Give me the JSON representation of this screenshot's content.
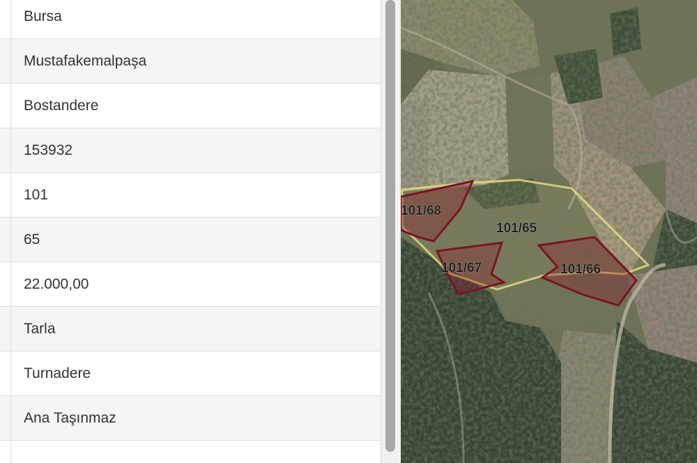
{
  "property_info": {
    "rows": [
      {
        "value": "Bursa"
      },
      {
        "value": "Mustafakemalpaşa"
      },
      {
        "value": "Bostandere"
      },
      {
        "value": "153932"
      },
      {
        "value": "101"
      },
      {
        "value": "65"
      },
      {
        "value": "22.000,00"
      },
      {
        "value": "Tarla"
      },
      {
        "value": "Turnadere"
      },
      {
        "value": "Ana Taşınmaz"
      },
      {
        "value": ""
      }
    ]
  },
  "map": {
    "layer": "satellite",
    "parcels": [
      {
        "label": "101/68",
        "role": "neighbor",
        "color": "#8b1a2b"
      },
      {
        "label": "101/65",
        "role": "selected",
        "color": "#e8e27a"
      },
      {
        "label": "101/67",
        "role": "neighbor",
        "color": "#8b1a2b"
      },
      {
        "label": "101/66",
        "role": "neighbor",
        "color": "#8b1a2b"
      }
    ]
  },
  "colors": {
    "row_alt": "#f5f5f5",
    "border": "#dddddd",
    "text": "#333333",
    "selected_outline": "#e8e27a",
    "neighbor_outline": "#8b1a2b"
  }
}
